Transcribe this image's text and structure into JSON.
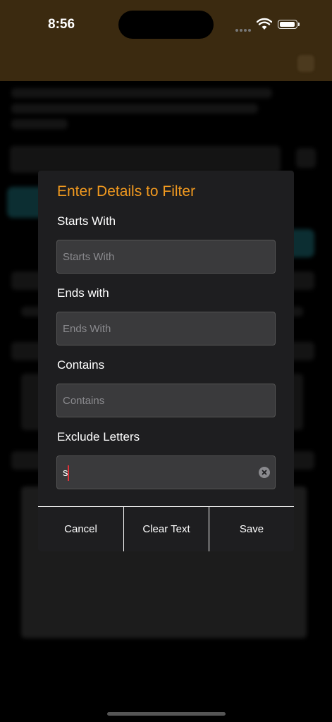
{
  "status_bar": {
    "time": "8:56"
  },
  "dialog": {
    "title": "Enter Details to Filter",
    "fields": [
      {
        "label": "Starts With",
        "placeholder": "Starts With",
        "value": ""
      },
      {
        "label": "Ends with",
        "placeholder": "Ends With",
        "value": ""
      },
      {
        "label": "Contains",
        "placeholder": "Contains",
        "value": ""
      },
      {
        "label": "Exclude Letters",
        "placeholder": "",
        "value": "s"
      }
    ],
    "buttons": {
      "cancel": "Cancel",
      "clear": "Clear Text",
      "save": "Save"
    }
  },
  "colors": {
    "accent": "#f29a1f",
    "header_bg": "#3b2a10",
    "dialog_bg": "#1e1e20",
    "field_bg": "#3a3a3c",
    "caret": "#e0323a"
  }
}
